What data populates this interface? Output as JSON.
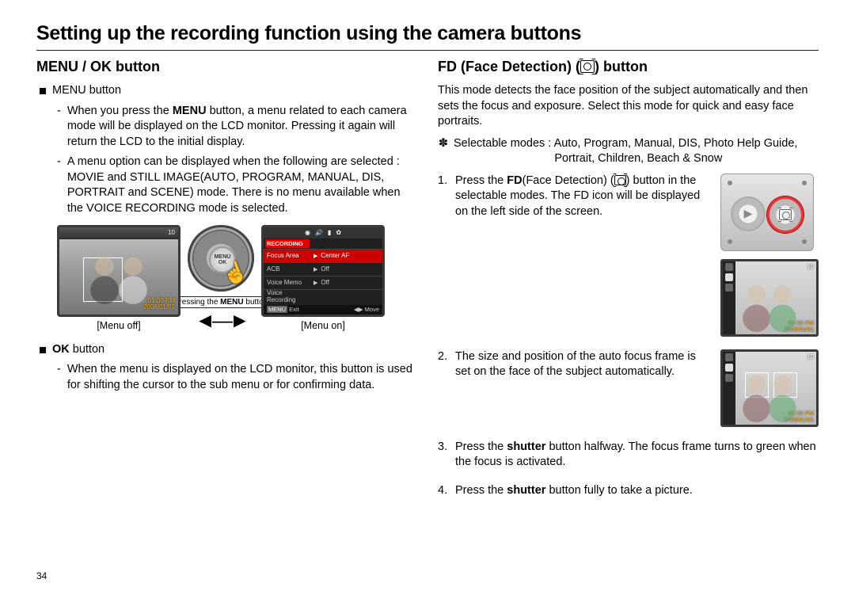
{
  "page": {
    "title": "Setting up the recording function using the camera buttons",
    "number": "34"
  },
  "left": {
    "heading": "MENU / OK button",
    "menuButton": {
      "label": "MENU button",
      "dash1_a": "When you press the ",
      "dash1_bold": "MENU",
      "dash1_b": " button, a menu related to each camera mode will be displayed on the LCD monitor. Pressing it again will return the LCD to the initial display.",
      "dash2": "A menu option can be displayed when the following are selected : MOVIE and STILL IMAGE(AUTO, PROGRAM, MANUAL, DIS, PORTRAIT and SCENE) mode. There is no menu available when the VOICE RECORDING mode is selected."
    },
    "illus": {
      "menuOffCaption": "[Menu off]",
      "menuOnCaption": "[Menu on]",
      "pressing_a": "[Pressing the ",
      "pressing_bold": "MENU",
      "pressing_b": " button]",
      "centerTop": "MENU",
      "centerBot": "OK",
      "lcd": {
        "topbarRight": "10",
        "time1": "01:00 PM",
        "time2": "2008/01/01"
      },
      "menuOn": {
        "recording": "RECORDING",
        "rows": [
          {
            "label": "Focus Area",
            "value": "Center AF"
          },
          {
            "label": "ACB",
            "value": "Off"
          },
          {
            "label": "Voice Memo",
            "value": "Off"
          },
          {
            "label": "Voice Recording",
            "value": ""
          }
        ],
        "footLeftTag": "MENU",
        "footLeft": "Exit",
        "footRight": "Move"
      }
    },
    "okButton": {
      "label_bold": "OK",
      "label_rest": " button",
      "dash": "When the menu is displayed on the LCD monitor, this button is used for shifting the cursor to the sub menu or for confirming data."
    }
  },
  "right": {
    "heading_a": "FD (Face Detection) (",
    "heading_b": ") button",
    "intro": "This mode detects the face position of the subject automatically and then sets the focus and exposure. Select this mode for quick and easy face portraits.",
    "modesLabel": "Selectable modes : ",
    "modes1": "Auto, Program, Manual, DIS, Photo Help Guide,",
    "modes2": "Portrait, Children, Beach & Snow",
    "steps": {
      "s1_a": "Press the ",
      "s1_bold": "FD",
      "s1_b": "(Face Detection) (",
      "s1_c": ") button in the selectable modes. The FD icon will be displayed on the left side of the screen.",
      "s2": "The size and position of the auto focus frame is set on the face of the subject automatically.",
      "s3_a": "Press the ",
      "s3_bold": "shutter",
      "s3_b": " button halfway. The focus frame turns to green when the focus is activated.",
      "s4_a": "Press the ",
      "s4_bold": "shutter",
      "s4_b": " button fully to take a picture."
    },
    "thumb": {
      "topbarRight": "10",
      "time1": "01:00 PM",
      "time2": "2008/01/01"
    }
  }
}
